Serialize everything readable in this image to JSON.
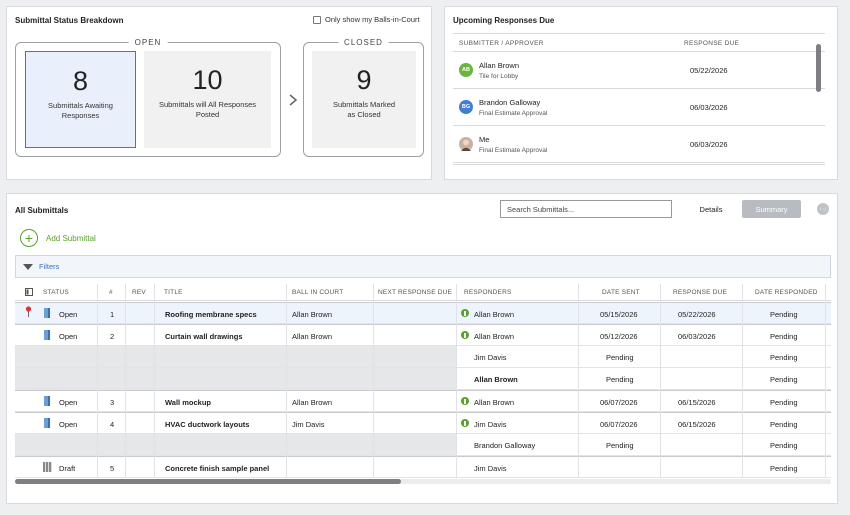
{
  "breakdown": {
    "title": "Submittal Status Breakdown",
    "bic_filter_label": "Only show my Balls-in-Court",
    "open_label": "OPEN",
    "closed_label": "CLOSED",
    "tiles": [
      {
        "count": "8",
        "label": "Submittals Awaiting Responses"
      },
      {
        "count": "10",
        "label": "Submittals will All Responses Posted"
      },
      {
        "count": "9",
        "label": "Submittals Marked as Closed"
      }
    ]
  },
  "upcoming": {
    "title": "Upcoming Responses Due",
    "col_submitter": "SUBMITTER / APPROVER",
    "col_due": "RESPONSE DUE",
    "rows": [
      {
        "initials": "AB",
        "color": "#6cb33f",
        "name": "Allan Brown",
        "sub": "Tile for Lobby",
        "due": "05/22/2026"
      },
      {
        "initials": "BG",
        "color": "#3f7fd4",
        "name": "Brandon Galloway",
        "sub": "Final Estimate Approval",
        "due": "06/03/2026"
      },
      {
        "initials": "",
        "color": "#a88a7a",
        "name": "Me",
        "sub": "Final Estimate Approval",
        "due": "06/03/2026"
      }
    ]
  },
  "all": {
    "title": "All Submittals",
    "search_placeholder": "Search Submittals...",
    "details_label": "Details",
    "summary_label": "Summary",
    "more_label": "···",
    "add_label": "Add Submittal",
    "filters_label": "Filters",
    "headers": {
      "status": "STATUS",
      "num": "#",
      "rev": "REV",
      "title": "TITLE",
      "bic": "BALL IN COURT",
      "next": "NEXT RESPONSE DUE",
      "responders": "RESPONDERS",
      "sent": "DATE SENT",
      "due": "RESPONSE DUE",
      "responded": "DATE RESPONDED"
    },
    "rows": [
      {
        "status": "Open",
        "num": "1",
        "title": "Roofing membrane specs",
        "bic": "Allan Brown",
        "responder": "Allan Brown",
        "sent": "05/15/2026",
        "due": "05/22/2026",
        "responded": "Pending"
      },
      {
        "status": "Open",
        "num": "2",
        "title": "Curtain wall drawings",
        "bic": "Allan Brown",
        "responder": "Allan Brown",
        "sent": "05/12/2026",
        "due": "06/03/2026",
        "responded": "Pending"
      },
      {
        "responder": "Jim Davis",
        "sent": "Pending",
        "responded": "Pending"
      },
      {
        "responder": "Allan Brown",
        "sent": "Pending",
        "responded": "Pending"
      },
      {
        "status": "Open",
        "num": "3",
        "title": "Wall mockup",
        "bic": "Allan Brown",
        "responder": "Allan Brown",
        "sent": "06/07/2026",
        "due": "06/15/2026",
        "responded": "Pending"
      },
      {
        "status": "Open",
        "num": "4",
        "title": "HVAC ductwork layouts",
        "bic": "Jim Davis",
        "responder": "Jim Davis",
        "sent": "06/07/2026",
        "due": "06/15/2026",
        "responded": "Pending"
      },
      {
        "responder": "Brandon Galloway",
        "sent": "Pending",
        "responded": "Pending"
      },
      {
        "status": "Draft",
        "num": "5",
        "title": "Concrete finish sample panel",
        "responder": "Jim Davis",
        "responded": "Pending"
      }
    ]
  },
  "colors": {
    "accent_green": "#5aa02c",
    "link_blue": "#3d6fb3",
    "selected_border": "#4a72c4"
  }
}
